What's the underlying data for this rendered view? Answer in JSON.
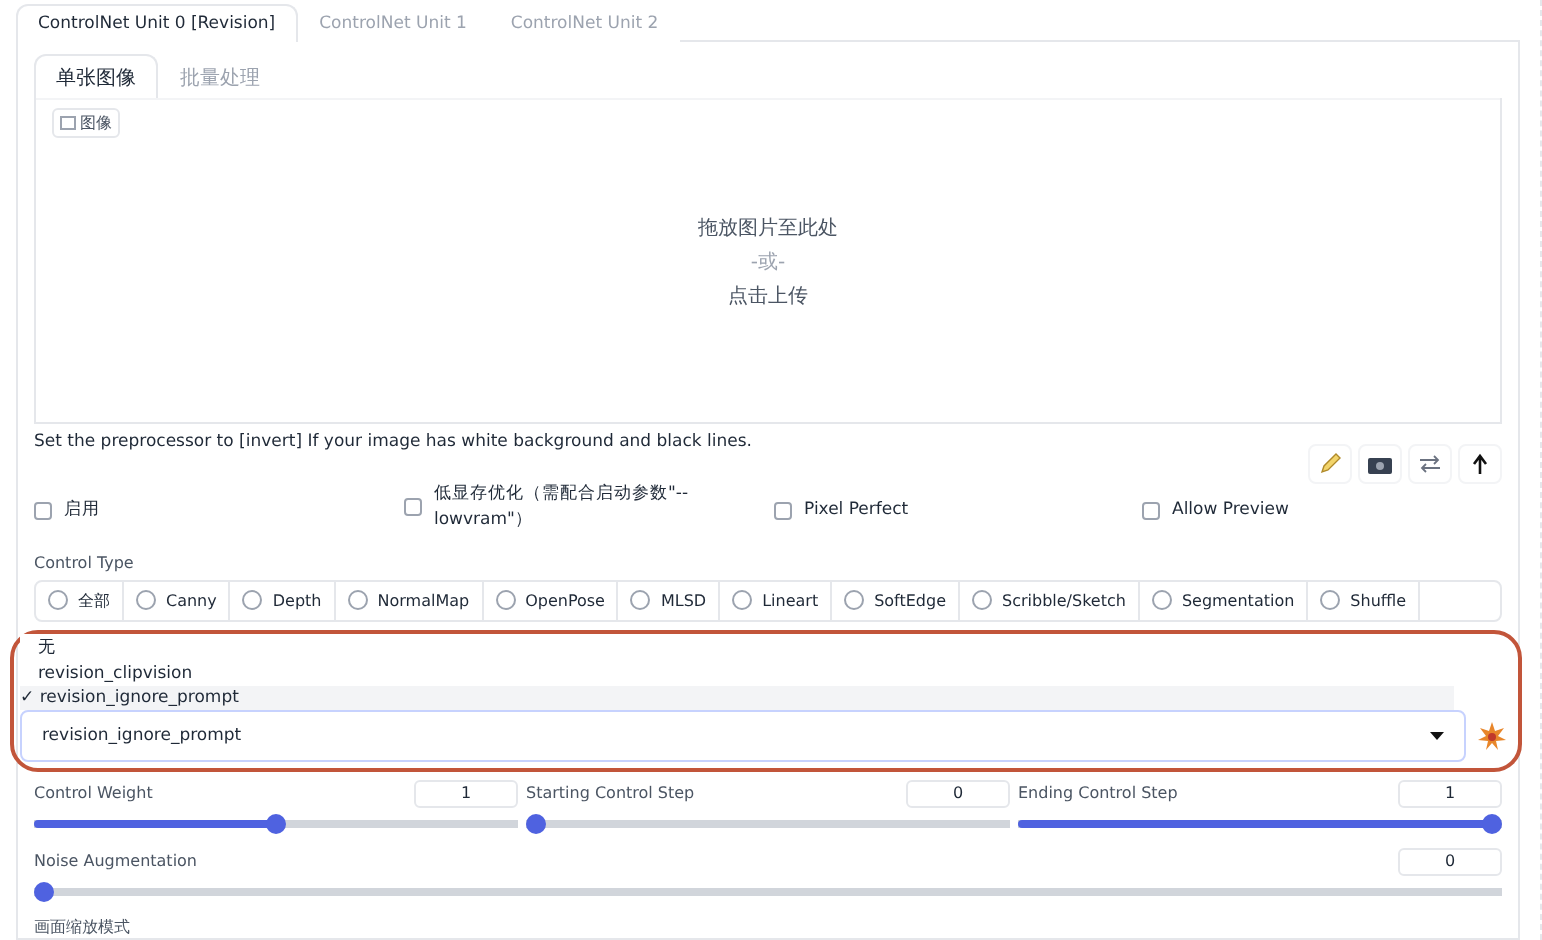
{
  "unit_tabs": [
    {
      "label": "ControlNet Unit 0 [Revision]",
      "selected": true
    },
    {
      "label": "ControlNet Unit 1",
      "selected": false
    },
    {
      "label": "ControlNet Unit 2",
      "selected": false
    }
  ],
  "image_tabs": [
    {
      "label": "单张图像",
      "selected": true
    },
    {
      "label": "批量处理",
      "selected": false
    }
  ],
  "upload": {
    "label": "图像",
    "drop_text": "拖放图片至此处",
    "or_text": "-或-",
    "click_text": "点击上传"
  },
  "hint": "Set the preprocessor to [invert] If your image has white background and black lines.",
  "options": [
    {
      "label": "启用",
      "checked": false
    },
    {
      "label": "低显存优化（需配合启动参数\"--lowvram\"）",
      "checked": false
    },
    {
      "label": "Pixel Perfect",
      "checked": false
    },
    {
      "label": "Allow Preview",
      "checked": false
    }
  ],
  "control_type": {
    "label": "Control Type",
    "choices": [
      {
        "label": "全部",
        "selected": false
      },
      {
        "label": "Canny",
        "selected": false
      },
      {
        "label": "Depth",
        "selected": false
      },
      {
        "label": "NormalMap",
        "selected": false
      },
      {
        "label": "OpenPose",
        "selected": false
      },
      {
        "label": "MLSD",
        "selected": false
      },
      {
        "label": "Lineart",
        "selected": false
      },
      {
        "label": "SoftEdge",
        "selected": false
      },
      {
        "label": "Scribble/Sketch",
        "selected": false
      },
      {
        "label": "Segmentation",
        "selected": false
      },
      {
        "label": "Shuffle",
        "selected": false
      }
    ]
  },
  "preprocessor": {
    "value": "revision_ignore_prompt",
    "check_mark": "✓",
    "options": [
      {
        "label": "无",
        "selected": false
      },
      {
        "label": "revision_clipvision",
        "selected": false
      },
      {
        "label": "revision_ignore_prompt",
        "selected": true
      }
    ]
  },
  "sliders": [
    {
      "label": "Control Weight",
      "value": "1",
      "level": 0.5
    },
    {
      "label": "Starting Control Step",
      "value": "0",
      "level": 0
    },
    {
      "label": "Ending Control Step",
      "value": "1",
      "level": 1
    }
  ],
  "noise": {
    "label": "Noise Augmentation",
    "value": "0",
    "level": 0
  },
  "resize_label": "画面缩放模式"
}
